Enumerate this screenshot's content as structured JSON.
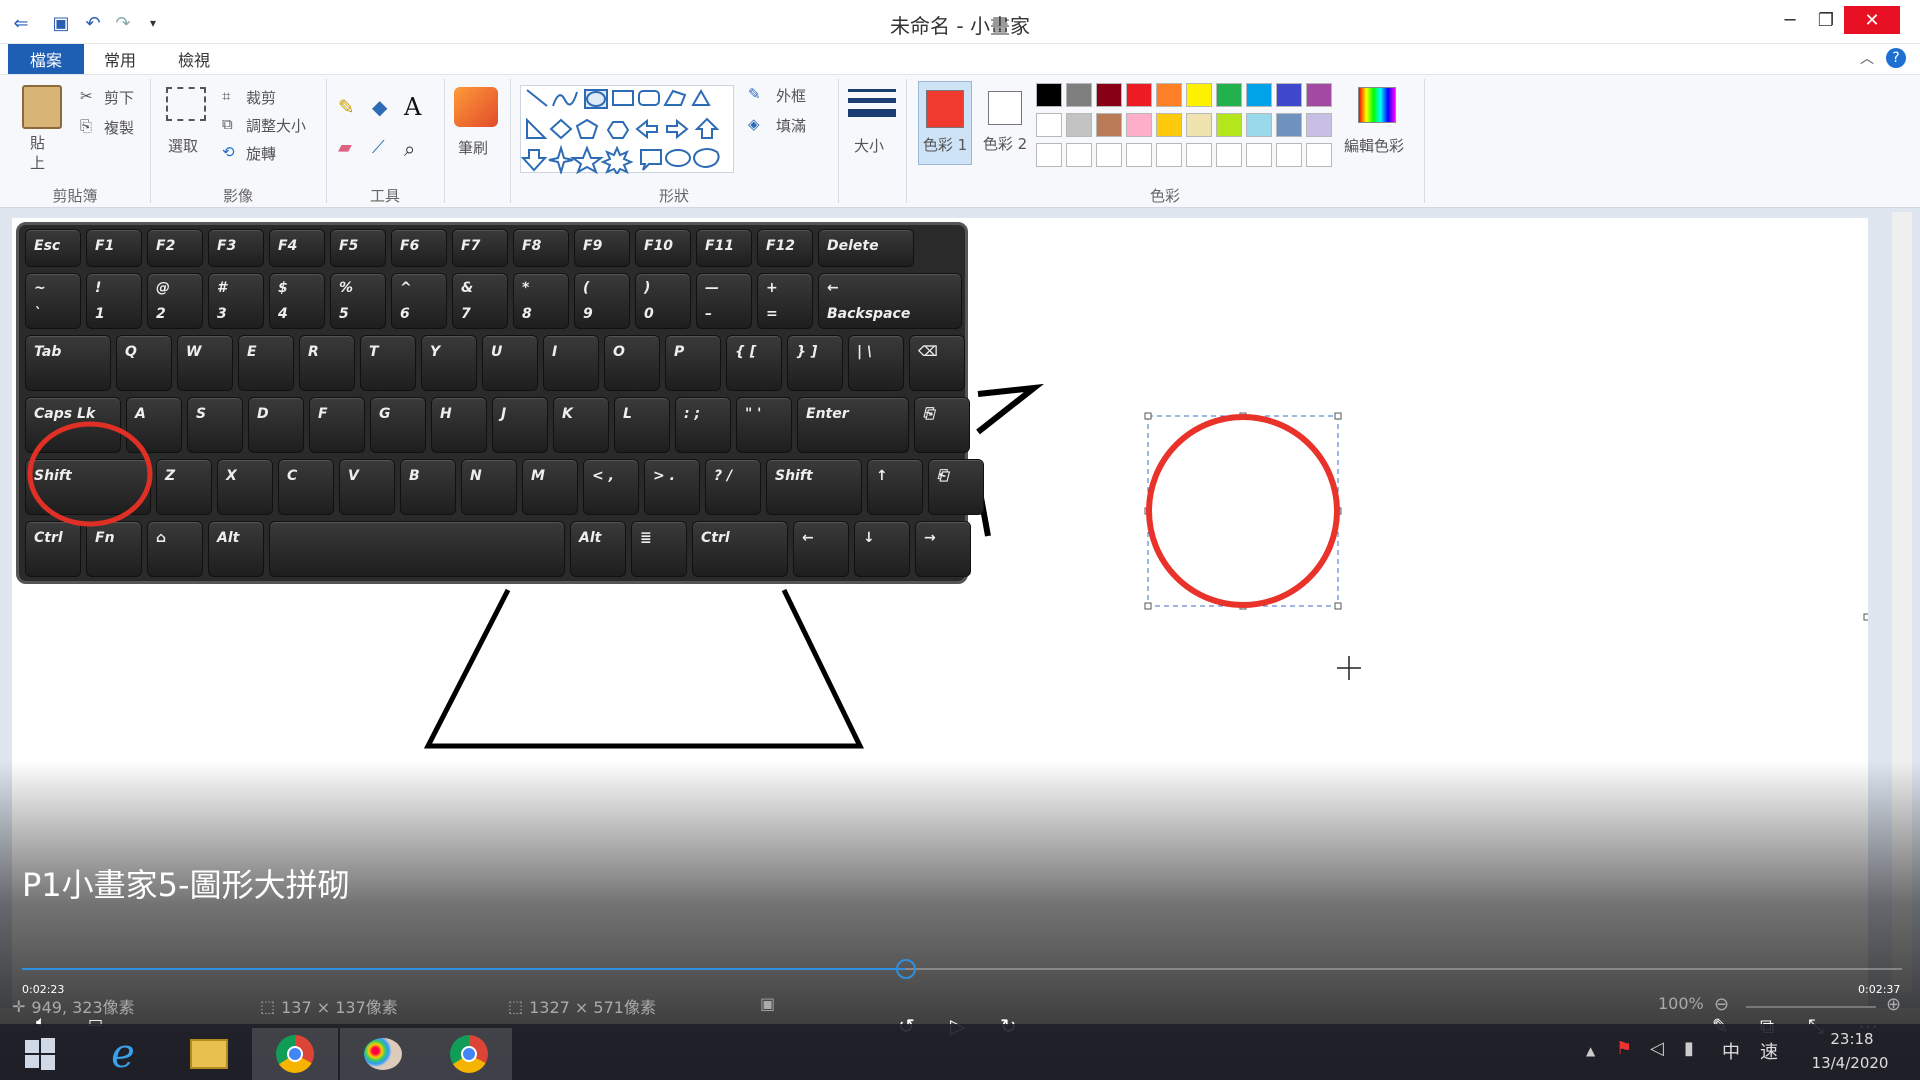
{
  "window": {
    "title": "未命名 - 小畫家",
    "minimize": "─",
    "restore": "❐",
    "close": "✕"
  },
  "tabs": [
    {
      "label": "檔案"
    },
    {
      "label": "常用"
    },
    {
      "label": "檢視"
    }
  ],
  "ribbon": {
    "clipboard": {
      "paste": "貼上",
      "cut": "剪下",
      "copy": "複製",
      "label": "剪貼簿"
    },
    "image": {
      "select": "選取",
      "crop": "裁剪",
      "resize": "調整大小",
      "rotate": "旋轉",
      "label": "影像"
    },
    "tools": {
      "label": "工具"
    },
    "brush": {
      "label": "筆刷"
    },
    "shapes": {
      "outline": "外框",
      "fill": "填滿",
      "label": "形狀"
    },
    "size": {
      "label": "大小"
    },
    "colors": {
      "color1": "色彩 1",
      "color2": "色彩 2",
      "edit": "編輯色彩",
      "label": "色彩",
      "primary": "#f03a2f",
      "secondary": "#ffffff",
      "palette_row1": [
        "#000000",
        "#7f7f7f",
        "#880015",
        "#ed1c24",
        "#ff7f27",
        "#fff200",
        "#22b14c",
        "#00a2e8",
        "#3f48cc",
        "#a349a4"
      ],
      "palette_row2": [
        "#ffffff",
        "#c3c3c3",
        "#b97a57",
        "#ffaec9",
        "#ffc90e",
        "#efe4b0",
        "#b5e61d",
        "#99d9ea",
        "#7092be",
        "#c8bfe7"
      ],
      "palette_row3": [
        "#ffffff",
        "#ffffff",
        "#ffffff",
        "#ffffff",
        "#ffffff",
        "#ffffff",
        "#ffffff",
        "#ffffff",
        "#ffffff",
        "#ffffff"
      ]
    }
  },
  "keyboard": {
    "row1": [
      "Esc",
      "F1",
      "F2",
      "F3",
      "F4",
      "F5",
      "F6",
      "F7",
      "F8",
      "F9",
      "F10",
      "F11",
      "F12",
      "Delete"
    ],
    "row2": [
      [
        "~",
        "`"
      ],
      [
        "!",
        "1"
      ],
      [
        "@",
        "2"
      ],
      [
        "#",
        "3"
      ],
      [
        "$",
        "4"
      ],
      [
        "%",
        "5"
      ],
      [
        "^",
        "6"
      ],
      [
        "&",
        "7"
      ],
      [
        "*",
        "8"
      ],
      [
        "(",
        "9"
      ],
      [
        ")",
        "0"
      ],
      [
        "—",
        "–"
      ],
      [
        "+",
        "="
      ],
      [
        "←",
        "Backspace"
      ]
    ],
    "row3": [
      "Tab",
      "Q",
      "W",
      "E",
      "R",
      "T",
      "Y",
      "U",
      "I",
      "O",
      "P",
      "{ [",
      "} ]",
      "| \\"
    ],
    "row4": [
      "Caps Lk",
      "A",
      "S",
      "D",
      "F",
      "G",
      "H",
      "J",
      "K",
      "L",
      ": ;",
      "\" '",
      "Enter"
    ],
    "row5": [
      "Shift",
      "Z",
      "X",
      "C",
      "V",
      "B",
      "N",
      "M",
      "< ,",
      "> .",
      "? /",
      "Shift",
      "↑"
    ],
    "row6": [
      "Ctrl",
      "Fn",
      "Alt",
      "Alt",
      "Ctrl",
      "←",
      "↓",
      "→"
    ]
  },
  "video": {
    "title": "P1小畫家5-圖形大拼砌",
    "time_current": "0:02:23",
    "time_total": "0:02:37",
    "progress": 0.47
  },
  "status": {
    "cursor": "949, 323像素",
    "selection": "137 × 137像素",
    "canvas_size": "1327 × 571像素",
    "zoom": "100%"
  },
  "taskbar": {
    "clock_time": "23:18",
    "clock_date": "13/4/2020",
    "ime": "中",
    "ime2": "速"
  }
}
